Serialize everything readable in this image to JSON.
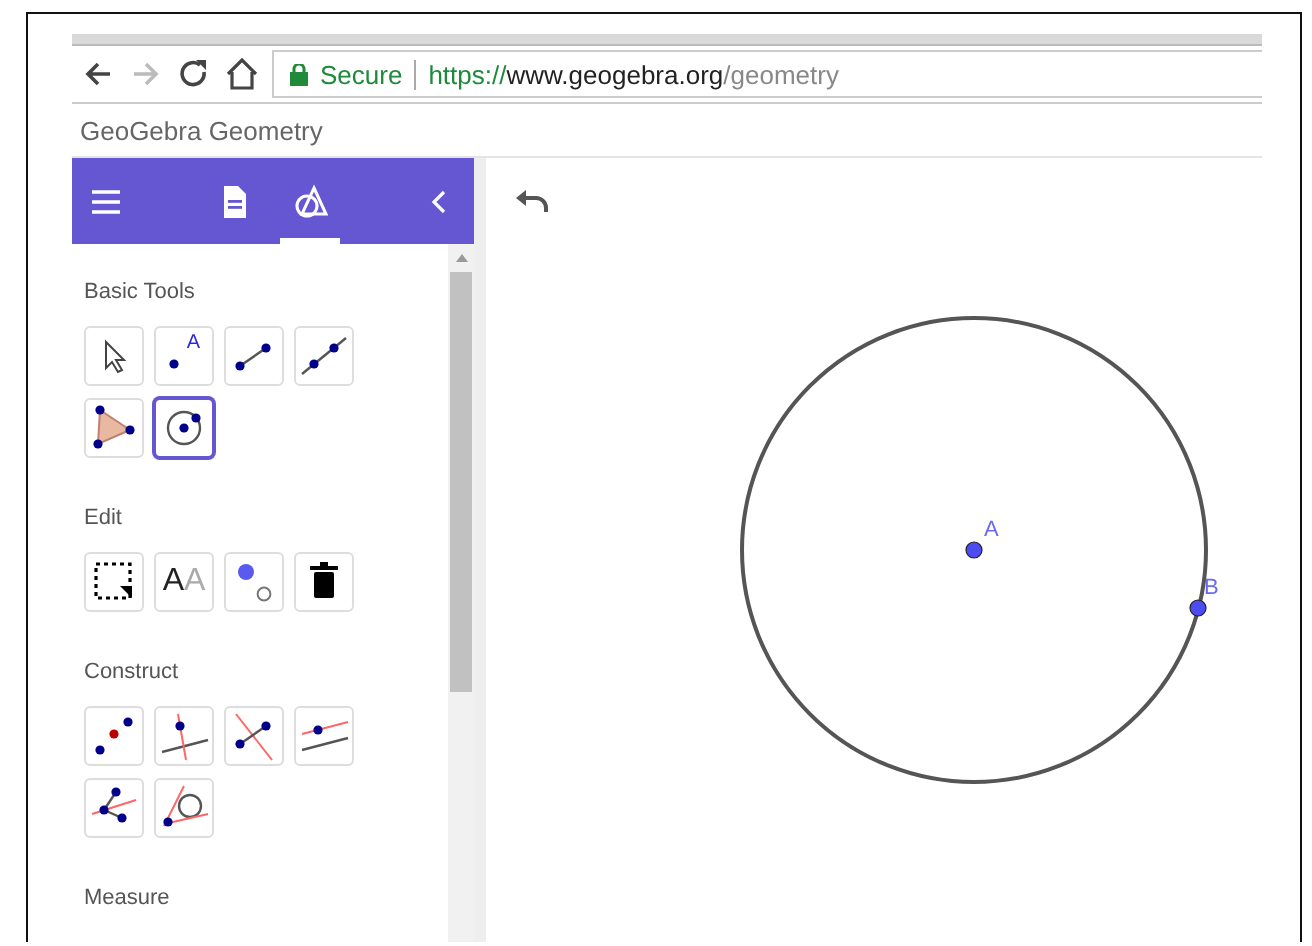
{
  "browser": {
    "secure_label": "Secure",
    "url": {
      "scheme": "https://",
      "host": "www.geogebra.org",
      "path": "/geometry"
    }
  },
  "app_title": "GeoGebra Geometry",
  "header_tabs": [
    {
      "kind": "document",
      "selected": false
    },
    {
      "kind": "tools",
      "selected": true
    }
  ],
  "tool_sections": [
    {
      "title": "Basic Tools",
      "tools": [
        {
          "kind": "move",
          "selected": false
        },
        {
          "kind": "point",
          "glyphs": [
            "A"
          ],
          "selected": false
        },
        {
          "kind": "segment",
          "selected": false
        },
        {
          "kind": "line",
          "selected": false
        },
        {
          "kind": "polygon",
          "selected": false
        },
        {
          "kind": "circle",
          "selected": true
        }
      ]
    },
    {
      "title": "Edit",
      "tools": [
        {
          "kind": "select",
          "selected": false
        },
        {
          "kind": "text",
          "glyphs": [
            "A",
            "A"
          ],
          "selected": false
        },
        {
          "kind": "style",
          "selected": false
        },
        {
          "kind": "delete",
          "selected": false
        }
      ]
    },
    {
      "title": "Construct",
      "tools": [
        {
          "kind": "midpoint",
          "selected": false
        },
        {
          "kind": "perpendicular",
          "selected": false
        },
        {
          "kind": "bisector",
          "selected": false
        },
        {
          "kind": "parallel",
          "selected": false
        },
        {
          "kind": "angle-bisector",
          "selected": false
        },
        {
          "kind": "tangent",
          "selected": false
        }
      ]
    },
    {
      "title": "Measure"
    }
  ],
  "canvas": {
    "points": [
      {
        "label": "A",
        "kind": "center"
      },
      {
        "label": "B",
        "kind": "on-circle"
      }
    ]
  }
}
